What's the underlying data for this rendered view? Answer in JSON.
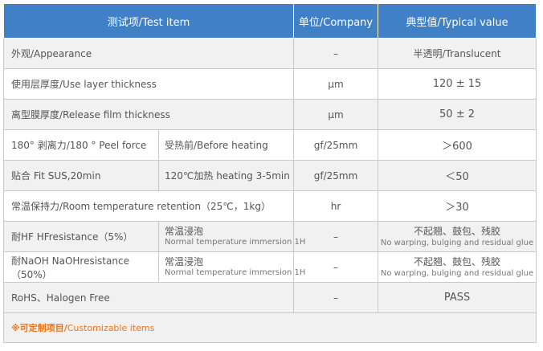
{
  "header": {
    "item": "测试项/Test item",
    "unit": "单位/Company",
    "value": "典型值/Typical value"
  },
  "rows": [
    {
      "item": "外观/Appearance",
      "unit": "–",
      "value": "半透明/Translucent"
    },
    {
      "item": "使用层厚度/Use layer thickness",
      "unit": "μm",
      "value": "120 ± 15"
    },
    {
      "item": "离型膜厚度/Release film thickness",
      "unit": "μm",
      "value": "50 ± 2"
    },
    {
      "item": "180° 剥离力/180 °  Peel force",
      "condition": "受热前/Before heating",
      "unit": "gf/25mm",
      "value": "＞600"
    },
    {
      "item": "贴合 Fit SUS,20min",
      "condition": "120℃加热 heating 3-5min",
      "unit": "gf/25mm",
      "value": "＜50"
    },
    {
      "item": "常温保持力/Room temperature retention（25℃，1kg）",
      "unit": "hr",
      "value": "＞30"
    },
    {
      "item": "耐HF HFresistance（5%）",
      "condition": "常温浸泡",
      "condition_en": "Normal temperature immersion 1H",
      "unit": "–",
      "value": "不起翘、鼓包、残胶",
      "value_en": "No warping, bulging and residual glue"
    },
    {
      "item": "耐NaOH NaOHresistance（50%）",
      "condition": "常温浸泡",
      "condition_en": "Normal temperature immersion 1H",
      "unit": "–",
      "value": "不起翘、鼓包、残胶",
      "value_en": "No warping, bulging and residual glue"
    },
    {
      "item": "RoHS、Halogen Free",
      "unit": "–",
      "value": "PASS"
    }
  ],
  "footer": {
    "note_zh": "※可定制项目/",
    "note_en": "Customizable items"
  },
  "colors": {
    "header_bg": "#3f80c6",
    "footer_text": "#e8751d",
    "row_alt_bg": "#f1f1f1"
  }
}
